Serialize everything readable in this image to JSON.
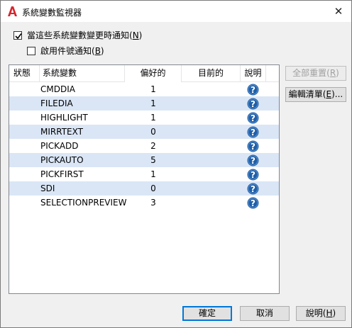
{
  "window": {
    "title": "系統變數監視器"
  },
  "options": {
    "notify_label": "當這些系統變數變更時通知(",
    "notify_key": "N",
    "notify_end": ")",
    "notify_checked": true,
    "balloon_label": "啟用件號通知(",
    "balloon_key": "B",
    "balloon_end": ")",
    "balloon_checked": false
  },
  "table": {
    "columns": [
      "狀態",
      "系統變數",
      "偏好的",
      "目前的",
      "說明"
    ],
    "rows": [
      {
        "name": "CMDDIA",
        "preferred": "1",
        "current": ""
      },
      {
        "name": "FILEDIA",
        "preferred": "1",
        "current": ""
      },
      {
        "name": "HIGHLIGHT",
        "preferred": "1",
        "current": ""
      },
      {
        "name": "MIRRTEXT",
        "preferred": "0",
        "current": ""
      },
      {
        "name": "PICKADD",
        "preferred": "2",
        "current": ""
      },
      {
        "name": "PICKAUTO",
        "preferred": "5",
        "current": ""
      },
      {
        "name": "PICKFIRST",
        "preferred": "1",
        "current": ""
      },
      {
        "name": "SDI",
        "preferred": "0",
        "current": ""
      },
      {
        "name": "SELECTIONPREVIEW",
        "preferred": "3",
        "current": ""
      }
    ]
  },
  "side_buttons": {
    "reset_all": "全部重置(",
    "reset_all_key": "R",
    "reset_all_end": ")",
    "edit_list": "編輯清單(",
    "edit_list_key": "E",
    "edit_list_end": ")..."
  },
  "footer": {
    "ok": "確定",
    "cancel": "取消",
    "help": "說明(",
    "help_key": "H",
    "help_end": ")"
  },
  "colors": {
    "accent": "#0078d7",
    "row_alt": "#dae6f6",
    "help_icon": "#1f5fa8",
    "app_icon": "#d7262c"
  }
}
